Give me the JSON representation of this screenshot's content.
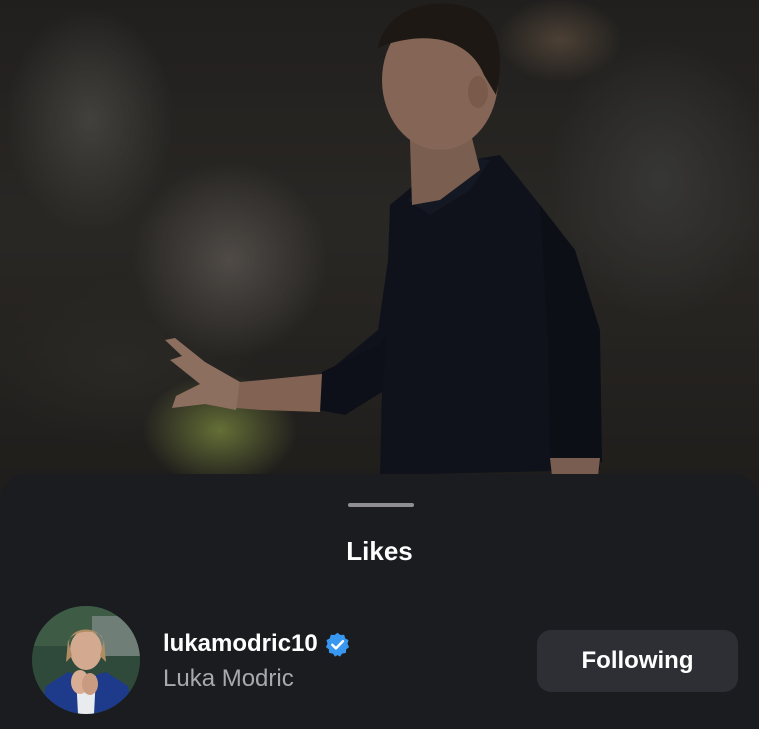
{
  "sheet": {
    "title": "Likes"
  },
  "likes": [
    {
      "username": "lukamodric10",
      "full_name": "Luka Modric",
      "verified": true,
      "button_label": "Following"
    }
  ],
  "colors": {
    "sheet_background": "#1b1c20",
    "button_background": "#2e2f34",
    "verified_badge": "#3897f0",
    "secondary_text": "#a8a8ad"
  },
  "icons": {
    "verified": "verified-badge-icon"
  }
}
